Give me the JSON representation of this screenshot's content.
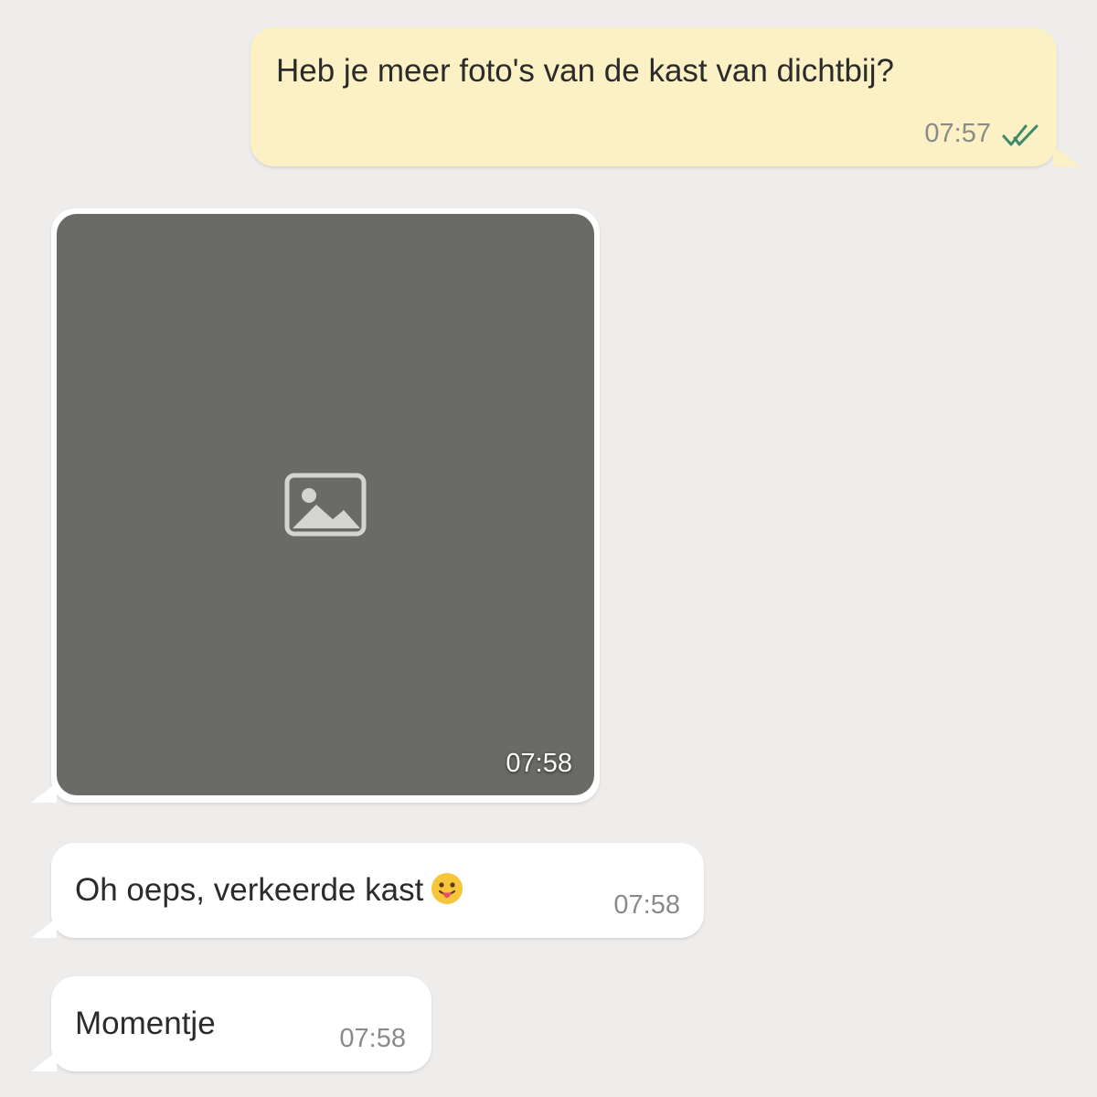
{
  "colors": {
    "background": "#efedeb",
    "outgoing_bubble": "#fbf1c4",
    "incoming_bubble": "#ffffff",
    "read_ticks": "#3e8a6a",
    "timestamp": "#8a8a8a"
  },
  "messages": [
    {
      "direction": "outgoing",
      "type": "text",
      "text": "Heb je meer foto's van de kast van dichtbij?",
      "time": "07:57",
      "status_icon": "double-check-read-icon"
    },
    {
      "direction": "incoming",
      "type": "image",
      "image_icon": "photo-attachment-placeholder",
      "time": "07:58"
    },
    {
      "direction": "incoming",
      "type": "text",
      "text": "Oh oeps,  verkeerde kast",
      "emoji": "tongue-out-emoji-icon",
      "time": "07:58"
    },
    {
      "direction": "incoming",
      "type": "text",
      "text": "Momentje",
      "time": "07:58"
    }
  ]
}
